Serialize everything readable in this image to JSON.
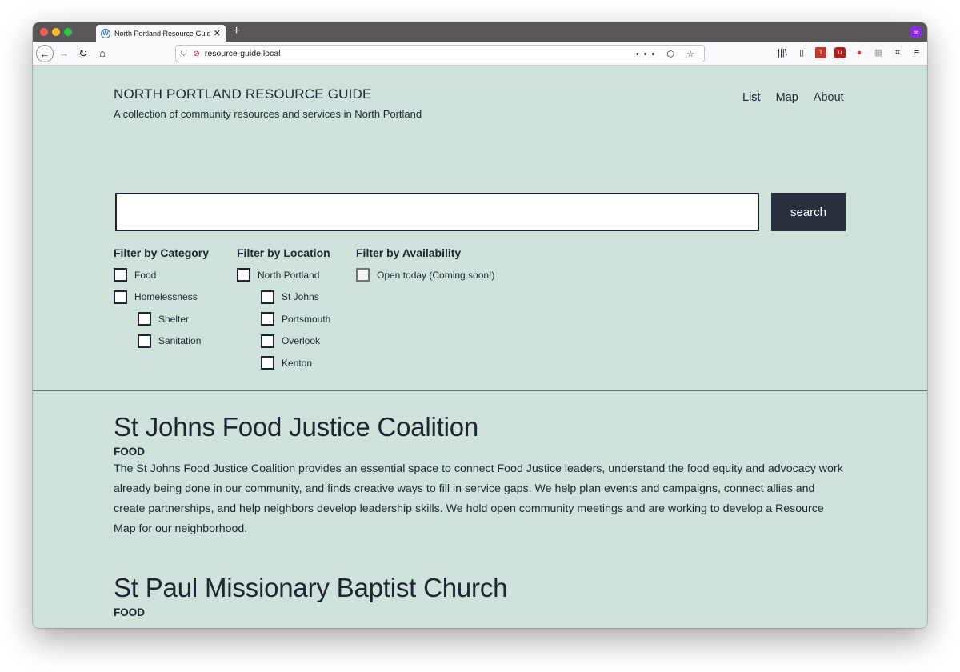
{
  "browser": {
    "tab_title": "North Portland Resource Guide",
    "tab_close": "✕",
    "new_tab": "+",
    "favicon": "wordpress-icon",
    "url": "resource-guide.local",
    "url_actions": "••• ⬡ ☆",
    "nav_icons": {
      "back": "←",
      "forward": "→",
      "reload": "↻",
      "home": "⌂"
    },
    "toolbar": {
      "library": "|||\\",
      "sidebar": "▯",
      "menu": "≡",
      "ext_badge_count": "1"
    }
  },
  "site": {
    "title": "NORTH PORTLAND RESOURCE GUIDE",
    "tagline": "A collection of community resources and services in North Portland",
    "nav": [
      {
        "label": "List",
        "active": true
      },
      {
        "label": "Map",
        "active": false
      },
      {
        "label": "About",
        "active": false
      }
    ]
  },
  "search": {
    "value": "",
    "button_label": "search"
  },
  "filters": {
    "category": {
      "heading": "Filter by Category",
      "options": [
        "Food",
        "Homelessness",
        "Shelter",
        "Sanitation"
      ]
    },
    "location": {
      "heading": "Filter by Location",
      "options": [
        "North Portland",
        "St Johns",
        "Portsmouth",
        "Overlook",
        "Kenton"
      ]
    },
    "availability": {
      "heading": "Filter by Availability",
      "options": [
        "Open today (Coming soon!)"
      ]
    }
  },
  "listings": [
    {
      "name": "St Johns Food Justice Coalition",
      "category": "FOOD",
      "description": "The St Johns Food Justice Coalition provides an essential space to connect Food Justice leaders, understand the food equity and advocacy work already being done in our community, and finds creative ways to fill in service gaps. We help plan events and campaigns, connect allies and create partnerships, and help neighbors develop leadership skills. We hold open community meetings and are working to develop a Resource Map for our neighborhood."
    },
    {
      "name": "St Paul Missionary Baptist Church",
      "category": "FOOD"
    }
  ]
}
